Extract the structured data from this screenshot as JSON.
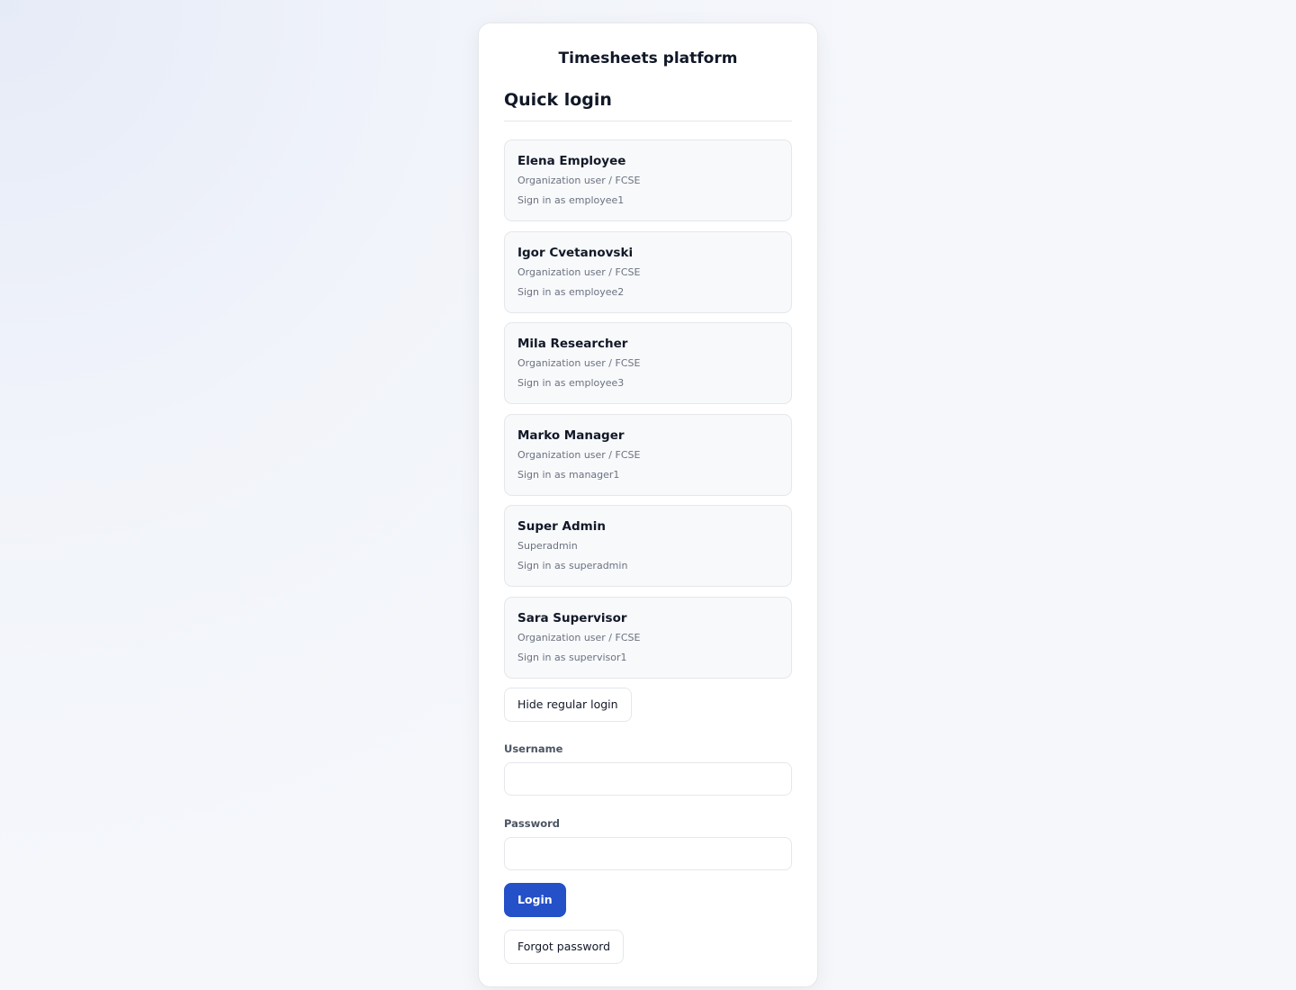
{
  "app": {
    "title": "Timesheets platform"
  },
  "quick_login": {
    "title": "Quick login",
    "accounts": [
      {
        "name": "Elena Employee",
        "role": "Organization user / FCSE",
        "action": "Sign in as employee1"
      },
      {
        "name": "Igor Cvetanovski",
        "role": "Organization user / FCSE",
        "action": "Sign in as employee2"
      },
      {
        "name": "Mila Researcher",
        "role": "Organization user / FCSE",
        "action": "Sign in as employee3"
      },
      {
        "name": "Marko Manager",
        "role": "Organization user / FCSE",
        "action": "Sign in as manager1"
      },
      {
        "name": "Super Admin",
        "role": "Superadmin",
        "action": "Sign in as superadmin"
      },
      {
        "name": "Sara Supervisor",
        "role": "Organization user / FCSE",
        "action": "Sign in as supervisor1"
      }
    ]
  },
  "regular_login": {
    "toggle_label": "Hide regular login",
    "username_label": "Username",
    "username_value": "",
    "password_label": "Password",
    "password_value": "",
    "login_label": "Login",
    "forgot_label": "Forgot password"
  },
  "colors": {
    "primary": "#2450c8",
    "card_background": "#ffffff",
    "quick_card_background": "#f8f9fb",
    "border": "#e5e7eb",
    "text": "#111827",
    "muted_text": "#6b7280"
  }
}
